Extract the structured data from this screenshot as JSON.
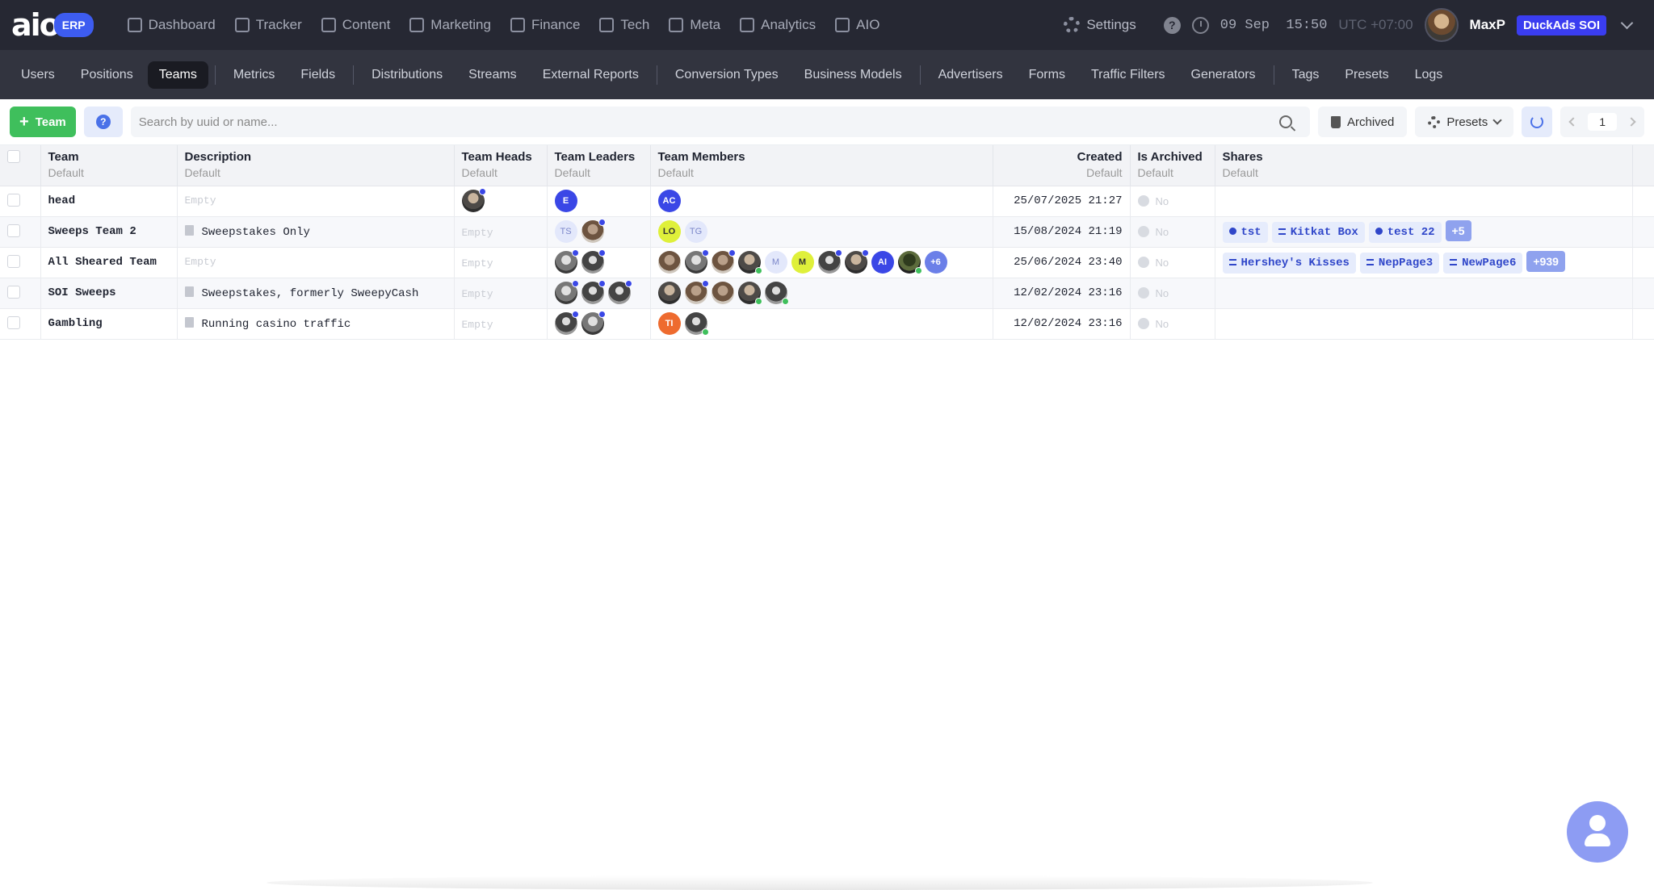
{
  "brand": {
    "logo": "aio",
    "badge": "ERP"
  },
  "main_nav": [
    "Dashboard",
    "Tracker",
    "Content",
    "Marketing",
    "Finance",
    "Tech",
    "Meta",
    "Analytics",
    "AIO"
  ],
  "header": {
    "settings": "Settings",
    "help": "?",
    "date": "09 Sep",
    "time": "15:50",
    "timezone": "UTC +07:00",
    "user": "MaxP",
    "company": "DuckAds SOI"
  },
  "sub_nav": {
    "groups": [
      [
        "Users",
        "Positions",
        "Teams"
      ],
      [
        "Metrics",
        "Fields"
      ],
      [
        "Distributions",
        "Streams",
        "External Reports"
      ],
      [
        "Conversion Types",
        "Business Models"
      ],
      [
        "Advertisers",
        "Forms",
        "Traffic Filters",
        "Generators"
      ],
      [
        "Tags",
        "Presets",
        "Logs"
      ]
    ],
    "active": "Teams"
  },
  "toolbar": {
    "add_label": "Team",
    "help": "?",
    "search_placeholder": "Search by uuid or name...",
    "archived_label": "Archived",
    "presets_label": "Presets",
    "page": "1"
  },
  "table": {
    "columns": [
      {
        "label": "Team",
        "sub": "Default"
      },
      {
        "label": "Description",
        "sub": "Default"
      },
      {
        "label": "Team Heads",
        "sub": "Default"
      },
      {
        "label": "Team Leaders",
        "sub": "Default"
      },
      {
        "label": "Team Members",
        "sub": "Default"
      },
      {
        "label": "Created",
        "sub": "Default"
      },
      {
        "label": "Is Archived",
        "sub": "Default"
      },
      {
        "label": "Shares",
        "sub": "Default"
      }
    ],
    "empty_text": "Empty",
    "no_text": "No",
    "rows": [
      {
        "name": "head",
        "description": "",
        "heads": [
          {
            "img": "p1",
            "dot": "blue"
          }
        ],
        "leaders": [
          {
            "text": "E",
            "color": "blue",
            "dot": "green"
          }
        ],
        "members": [
          {
            "text": "AC",
            "color": "blue",
            "dot": "blue"
          }
        ],
        "created": "25/07/2025 21:27",
        "archived": "No",
        "shares": []
      },
      {
        "name": "Sweeps Team 2",
        "description": "Sweepstakes Only",
        "heads": [],
        "leaders": [
          {
            "text": "TS",
            "color": "lightb",
            "dot": "blue"
          },
          {
            "img": "p3",
            "dot": "blue"
          }
        ],
        "members": [
          {
            "text": "LO",
            "color": "lime"
          },
          {
            "text": "TG",
            "color": "lightb"
          }
        ],
        "created": "15/08/2024 21:19",
        "archived": "No",
        "shares": [
          {
            "label": "tst",
            "icon": "dot"
          },
          {
            "label": "Kitkat Box",
            "icon": "list"
          },
          {
            "label": "test 22",
            "icon": "dot"
          },
          {
            "label": "+5",
            "icon": "plus"
          }
        ]
      },
      {
        "name": "All Sheared Team",
        "description": "",
        "heads": [],
        "leaders": [
          {
            "img": "p2",
            "dot": "blue"
          },
          {
            "img": "p5",
            "dot": "blue"
          }
        ],
        "members": [
          {
            "img": "p3"
          },
          {
            "img": "p2",
            "dot": "blue"
          },
          {
            "img": "p3",
            "dot": "blue"
          },
          {
            "img": "p1",
            "dot": "green"
          },
          {
            "text": "M",
            "color": "lightb"
          },
          {
            "text": "M",
            "color": "lime"
          },
          {
            "img": "p5",
            "dot": "blue"
          },
          {
            "img": "p1",
            "dot": "blue"
          },
          {
            "text": "AI",
            "color": "blue"
          },
          {
            "img": "p4",
            "dot": "green"
          },
          {
            "text": "+6",
            "color": "more"
          }
        ],
        "created": "25/06/2024 23:40",
        "archived": "No",
        "shares": [
          {
            "label": "Hershey's Kisses",
            "icon": "list"
          },
          {
            "label": "NepPage3",
            "icon": "list"
          },
          {
            "label": "NewPage6",
            "icon": "list"
          },
          {
            "label": "+939",
            "icon": "plus"
          }
        ]
      },
      {
        "name": "SOI Sweeps",
        "description": "Sweepstakes, formerly SweepyCash",
        "heads": [],
        "leaders": [
          {
            "img": "p2",
            "dot": "blue"
          },
          {
            "img": "p5",
            "dot": "blue"
          },
          {
            "img": "p5",
            "dot": "blue"
          }
        ],
        "members": [
          {
            "img": "p1"
          },
          {
            "img": "p3",
            "dot": "blue"
          },
          {
            "img": "p3"
          },
          {
            "img": "p1",
            "dot": "green"
          },
          {
            "img": "p5",
            "dot": "green"
          }
        ],
        "created": "12/02/2024 23:16",
        "archived": "No",
        "shares": []
      },
      {
        "name": "Gambling",
        "description": "Running casino traffic",
        "heads": [],
        "leaders": [
          {
            "img": "p5",
            "dot": "blue"
          },
          {
            "img": "p2",
            "dot": "blue"
          }
        ],
        "members": [
          {
            "text": "TI",
            "color": "orange"
          },
          {
            "img": "p5",
            "dot": "green"
          }
        ],
        "created": "12/02/2024 23:16",
        "archived": "No",
        "shares": []
      }
    ]
  }
}
